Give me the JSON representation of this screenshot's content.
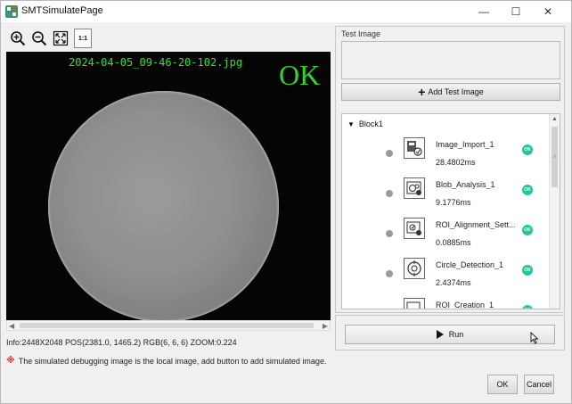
{
  "window": {
    "title": "SMTSimulatePage",
    "minimize_glyph": "—",
    "maximize_glyph": "☐",
    "close_glyph": "✕"
  },
  "toolbar": {
    "one_to_one_label": "1:1",
    "icons": [
      "zoom-in-icon",
      "zoom-out-icon",
      "fit-to-window-icon",
      "one-to-one-icon"
    ]
  },
  "viewer": {
    "filename": "2024-04-05_09-46-20-102.jpg",
    "result": "OK",
    "result_color": "#2fd22f"
  },
  "status": {
    "info": "Info:2448X2048 POS(2381.0, 1465.2) RGB(6, 6, 6) ZOOM:0.224",
    "warning_icon": "※",
    "warning": "The simulated debugging image is the local image, add button to add simulated image."
  },
  "test_image": {
    "label": "Test Image",
    "add_button_plus": "+",
    "add_button": "Add Test Image"
  },
  "block": {
    "name": "Block1",
    "tools": [
      {
        "name": "Image_Import_1",
        "time": "28.4802ms",
        "status": "OK",
        "icon": "image-import-icon"
      },
      {
        "name": "Blob_Analysis_1",
        "time": "9.1776ms",
        "status": "OK",
        "icon": "blob-analysis-icon"
      },
      {
        "name": "ROI_Alignment_Sett...",
        "time": "0.0885ms",
        "status": "OK",
        "icon": "roi-alignment-icon"
      },
      {
        "name": "Circle_Detection_1",
        "time": "2.4374ms",
        "status": "OK",
        "icon": "circle-detection-icon"
      },
      {
        "name": "ROI_Creation_1",
        "time": "",
        "status": "OK",
        "icon": "roi-creation-icon"
      }
    ]
  },
  "run": {
    "label": "Run"
  },
  "footer": {
    "ok": "OK",
    "cancel": "Cancel"
  },
  "colors": {
    "ok_badge": "#21c79a",
    "window_bg": "#f0f0f0"
  }
}
